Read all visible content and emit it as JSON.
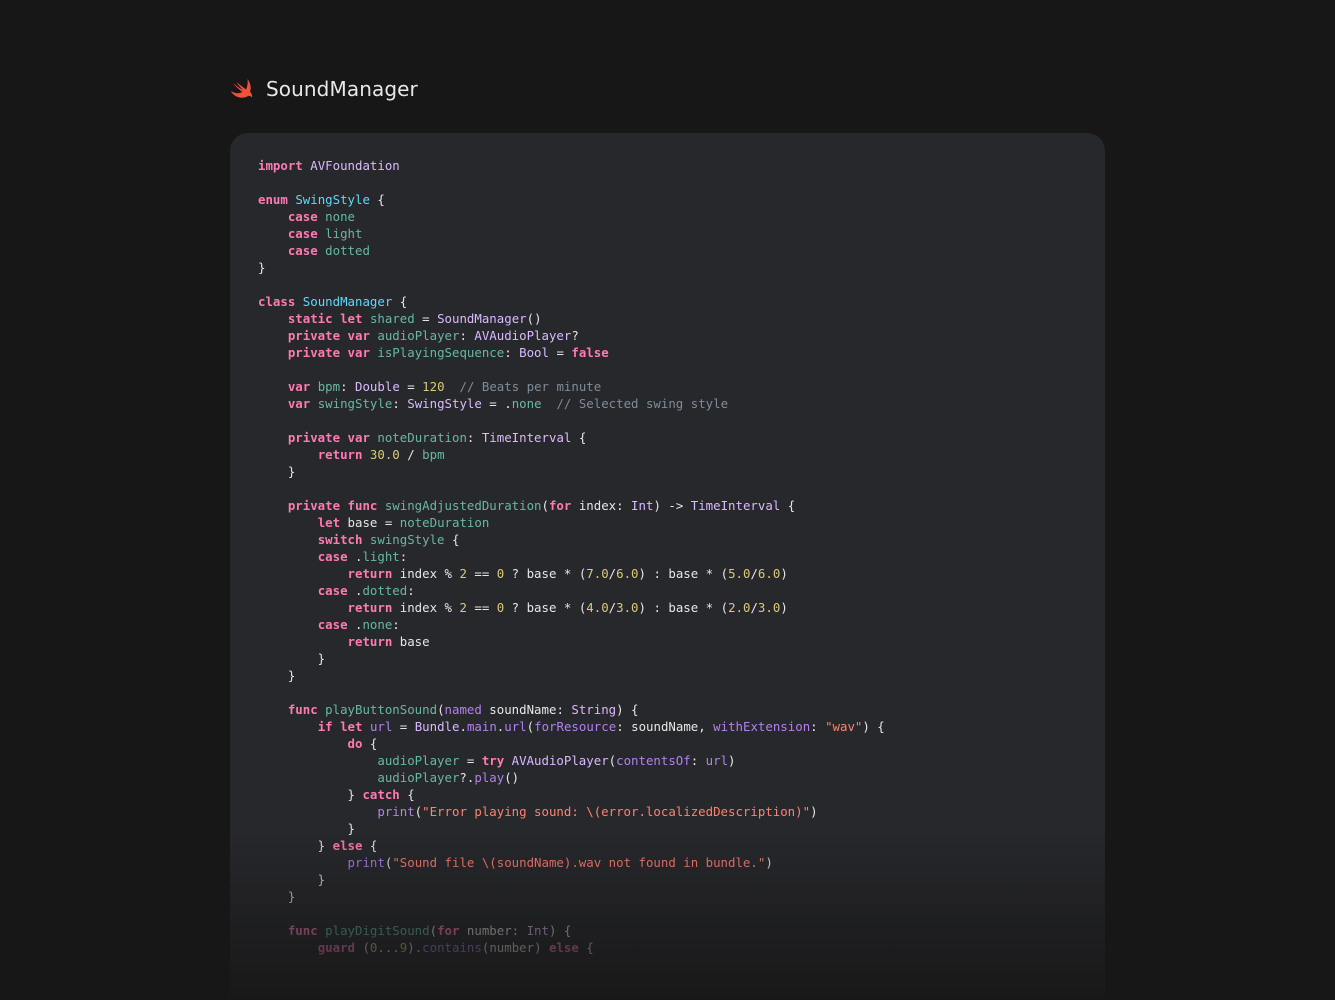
{
  "header": {
    "logo_icon": "swift-logo-icon",
    "title": "SoundManager"
  },
  "code": {
    "language": "swift",
    "lines": [
      "import AVFoundation",
      "",
      "enum SwingStyle {",
      "    case none",
      "    case light",
      "    case dotted",
      "}",
      "",
      "class SoundManager {",
      "    static let shared = SoundManager()",
      "    private var audioPlayer: AVAudioPlayer?",
      "    private var isPlayingSequence: Bool = false",
      "",
      "    var bpm: Double = 120  // Beats per minute",
      "    var swingStyle: SwingStyle = .none  // Selected swing style",
      "",
      "    private var noteDuration: TimeInterval {",
      "        return 30.0 / bpm",
      "    }",
      "",
      "    private func swingAdjustedDuration(for index: Int) -> TimeInterval {",
      "        let base = noteDuration",
      "        switch swingStyle {",
      "        case .light:",
      "            return index % 2 == 0 ? base * (7.0/6.0) : base * (5.0/6.0)",
      "        case .dotted:",
      "            return index % 2 == 0 ? base * (4.0/3.0) : base * (2.0/3.0)",
      "        case .none:",
      "            return base",
      "        }",
      "    }",
      "",
      "    func playButtonSound(named soundName: String) {",
      "        if let url = Bundle.main.url(forResource: soundName, withExtension: \"wav\") {",
      "            do {",
      "                audioPlayer = try AVAudioPlayer(contentsOf: url)",
      "                audioPlayer?.play()",
      "            } catch {",
      "                print(\"Error playing sound: \\(error.localizedDescription)\")",
      "            }",
      "        } else {",
      "            print(\"Sound file \\(soundName).wav not found in bundle.\")",
      "        }",
      "    }",
      "",
      "    func playDigitSound(for number: Int) {",
      "        guard (0...9).contains(number) else {"
    ]
  },
  "colors": {
    "page_background": "#171717",
    "card_background": "#27282c",
    "keyword": "#ff7ab2",
    "type_declaration": "#5dd8ff",
    "type": "#dabaff",
    "identifier": "#67b7a4",
    "parameter_label": "#4eb0cc",
    "number": "#d9c97c",
    "string": "#ff8170",
    "comment": "#7f8c98",
    "method": "#b281eb"
  }
}
